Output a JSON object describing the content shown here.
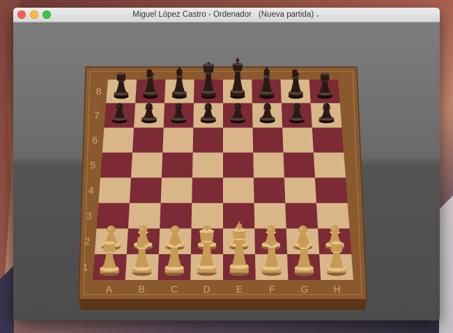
{
  "window": {
    "title_players": "Miguel López Castro - Ordenador",
    "title_game": "(Nueva partida)",
    "title_chevron": "⌄"
  },
  "board": {
    "ranks": [
      "8",
      "7",
      "6",
      "5",
      "4",
      "3",
      "2",
      "1"
    ],
    "files": [
      "A",
      "B",
      "C",
      "D",
      "E",
      "F",
      "G",
      "H"
    ],
    "colors": {
      "light_square": "#d8b688",
      "dark_square": "#7c2a36",
      "frame": "#8a5a2e",
      "coordinate_text": "#c9a978",
      "dark_piece": "#2a1a17",
      "light_piece": "#c79a55"
    },
    "pieces": {
      "8": [
        "black-rook",
        "black-knight",
        "black-bishop",
        "black-queen",
        "black-king",
        "black-bishop",
        "black-knight",
        "black-rook"
      ],
      "7": [
        "black-pawn",
        "black-pawn",
        "black-pawn",
        "black-pawn",
        "black-pawn",
        "black-pawn",
        "black-pawn",
        "black-pawn"
      ],
      "2": [
        "white-pawn",
        "white-pawn",
        "white-pawn",
        "white-pawn",
        "white-pawn",
        "white-pawn",
        "white-pawn",
        "white-pawn"
      ],
      "1": [
        "white-rook",
        "white-knight",
        "white-bishop",
        "white-queen",
        "white-king",
        "white-bishop",
        "white-knight",
        "white-rook"
      ]
    }
  }
}
